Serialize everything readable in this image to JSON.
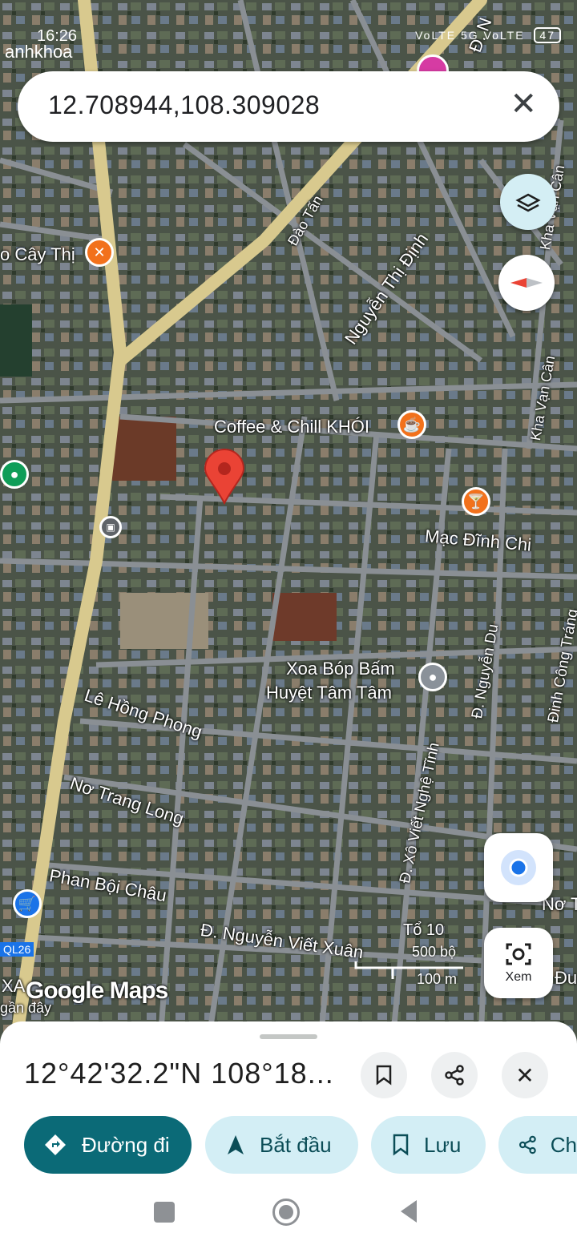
{
  "status": {
    "time": "16:26",
    "user": "anhkhoa",
    "signal": "VoLTE 5G VoLTE",
    "battery": "47"
  },
  "search": {
    "query": "12.708944,108.309028"
  },
  "map": {
    "labels": {
      "cay_thi": "o Cây Thị",
      "dao_tan": "Đào Tấn",
      "nguyen_thi_dinh": "Nguyễn Thị Định",
      "kha_van_can_top": "Kha Vạn Cân",
      "kha_van_can": "Kha Vạn Cân",
      "coffee": "Coffee & Chill KHÓI",
      "mac_dinh_chi": "Mạc Đĩnh Chi",
      "xoa_bop_1": "Xoa Bóp Bấm",
      "xoa_bop_2": "Huyệt Tâm Tâm",
      "nguyen_du": "Đ. Nguyễn Du",
      "dinh_cong_trang": "Đinh Công Tráng",
      "le_hong_phong": "Lê Hồng Phong",
      "no_trang_long": "Nơ Trang Long",
      "xo_viet_nghe_tinh": "Đ. Xô Viết Nghệ Tĩnh",
      "phan_boi_chau": "Phan Bội Châu",
      "nguyen_viet_xuan": "Đ. Nguyễn Viết Xuân",
      "to_10": "Tổ 10",
      "ql26": "QL26",
      "xa": "XA",
      "gan_day": "gần đây",
      "no_tr": "Nơ Tr",
      "du": "Đu",
      "google_maps": "Google Maps",
      "dn": "Đ. N"
    },
    "scale": {
      "top": "500 bộ",
      "bottom": "100 m"
    }
  },
  "controls": {
    "xem_label": "Xem"
  },
  "sheet": {
    "coords": "12°42'32.2\"N 108°18...",
    "actions": {
      "directions": "Đường đi",
      "start": "Bắt đầu",
      "save": "Lưu",
      "share": "Ch"
    }
  }
}
